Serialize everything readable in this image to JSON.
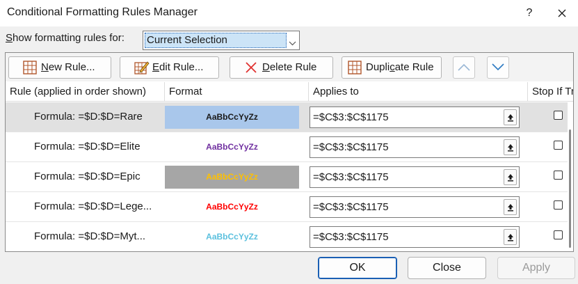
{
  "window": {
    "title": "Conditional Formatting Rules Manager",
    "help": "?"
  },
  "show_rules": {
    "label_pre": "",
    "label_accel": "S",
    "label_post": "how formatting rules for:",
    "selected": "Current Selection"
  },
  "toolbar": {
    "new_rule": {
      "accel": "N",
      "rest": "ew Rule..."
    },
    "edit_rule": {
      "accel": "E",
      "rest": "dit Rule..."
    },
    "delete_rule": {
      "accel": "D",
      "rest": "elete Rule"
    },
    "duplicate_rule": {
      "pre": "Dupli",
      "accel": "c",
      "post": "ate Rule"
    }
  },
  "columns": {
    "rule": "Rule (applied in order shown)",
    "format": "Format",
    "applies": "Applies to",
    "stop": "Stop If True"
  },
  "rules": [
    {
      "rule": "Formula: =$D:$D=Rare",
      "preview": "AaBbCcYyZz",
      "preview_color": "#1a1a1a",
      "preview_bg": "#a9c7eb",
      "applies": "=$C$3:$C$1175",
      "stop_if_true": false,
      "selected": true
    },
    {
      "rule": "Formula: =$D:$D=Elite",
      "preview": "AaBbCcYyZz",
      "preview_color": "#7030a0",
      "preview_bg": "#ffffff",
      "applies": "=$C$3:$C$1175",
      "stop_if_true": false,
      "selected": false
    },
    {
      "rule": "Formula: =$D:$D=Epic",
      "preview": "AaBbCcYyZz",
      "preview_color": "#ffc000",
      "preview_bg": "#a6a6a6",
      "applies": "=$C$3:$C$1175",
      "stop_if_true": false,
      "selected": false
    },
    {
      "rule": "Formula: =$D:$D=Lege...",
      "preview": "AaBbCcYyZz",
      "preview_color": "#ff0000",
      "preview_bg": "#ffffff",
      "applies": "=$C$3:$C$1175",
      "stop_if_true": false,
      "selected": false
    },
    {
      "rule": "Formula: =$D:$D=Myt...",
      "preview": "AaBbCcYyZz",
      "preview_color": "#5bc0de",
      "preview_bg": "#ffffff",
      "applies": "=$C$3:$C$1175",
      "stop_if_true": false,
      "selected": false
    }
  ],
  "buttons": {
    "ok": "OK",
    "close": "Close",
    "apply": "Apply"
  },
  "colors": {
    "selected_row": "#e1e1e1",
    "accent": "#1a5fb4"
  }
}
